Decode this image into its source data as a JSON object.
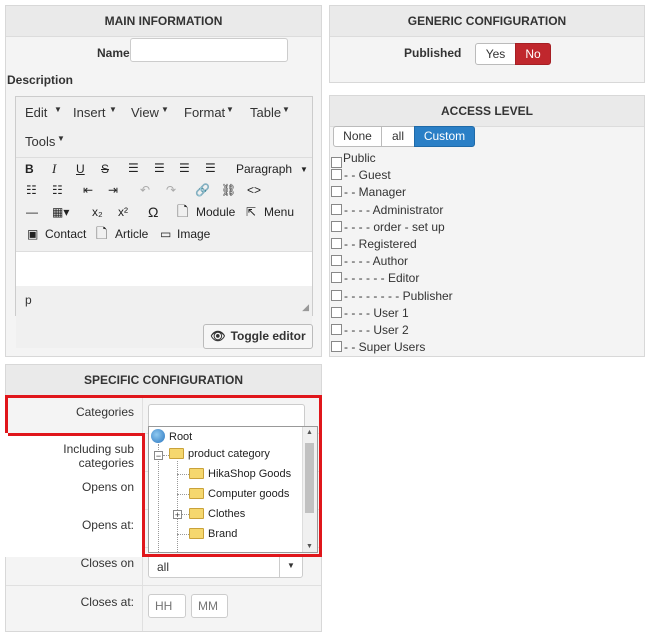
{
  "main": {
    "title": "MAIN INFORMATION",
    "name_label": "Name",
    "name_value": "",
    "description_label": "Description",
    "editor": {
      "menus": [
        "Edit",
        "Insert",
        "View",
        "Format",
        "Table",
        "Tools"
      ],
      "paragraph_label": "Paragraph",
      "module_label": "Module",
      "menu_label": "Menu",
      "contact_label": "Contact",
      "article_label": "Article",
      "image_label": "Image",
      "status_path": "p"
    },
    "toggle_label": "Toggle editor"
  },
  "generic": {
    "title": "GENERIC CONFIGURATION",
    "published_label": "Published",
    "yes_label": "Yes",
    "no_label": "No",
    "active_color": "#c0272d"
  },
  "access": {
    "title": "ACCESS LEVEL",
    "none_label": "None",
    "all_label": "all",
    "custom_label": "Custom",
    "active_color": "#2a7fc6",
    "groups": [
      "Public",
      "- - Guest",
      "- - Manager",
      "- - - - Administrator",
      "- - - - order - set up",
      "- - Registered",
      "- - - - Author",
      "- - - - - - Editor",
      "- - - - - - - - Publisher",
      "- - - - User 1",
      "- - - - User 2",
      "- - Super Users"
    ]
  },
  "specific": {
    "title": "SPECIFIC CONFIGURATION",
    "categories_label": "Categories",
    "sub_label": "Including sub categories",
    "opens_on_label": "Opens on",
    "opens_at_label": "Opens at:",
    "closes_on_label": "Closes on",
    "closes_on_value": "all",
    "closes_at_label": "Closes at:",
    "hh_placeholder": "HH",
    "mm_placeholder": "MM",
    "tree": {
      "root": "Root",
      "product_category": "product category",
      "children": [
        "HikaShop Goods",
        "Computer goods",
        "Clothes",
        "Brand"
      ]
    },
    "highlight_color": "#e0161b"
  }
}
